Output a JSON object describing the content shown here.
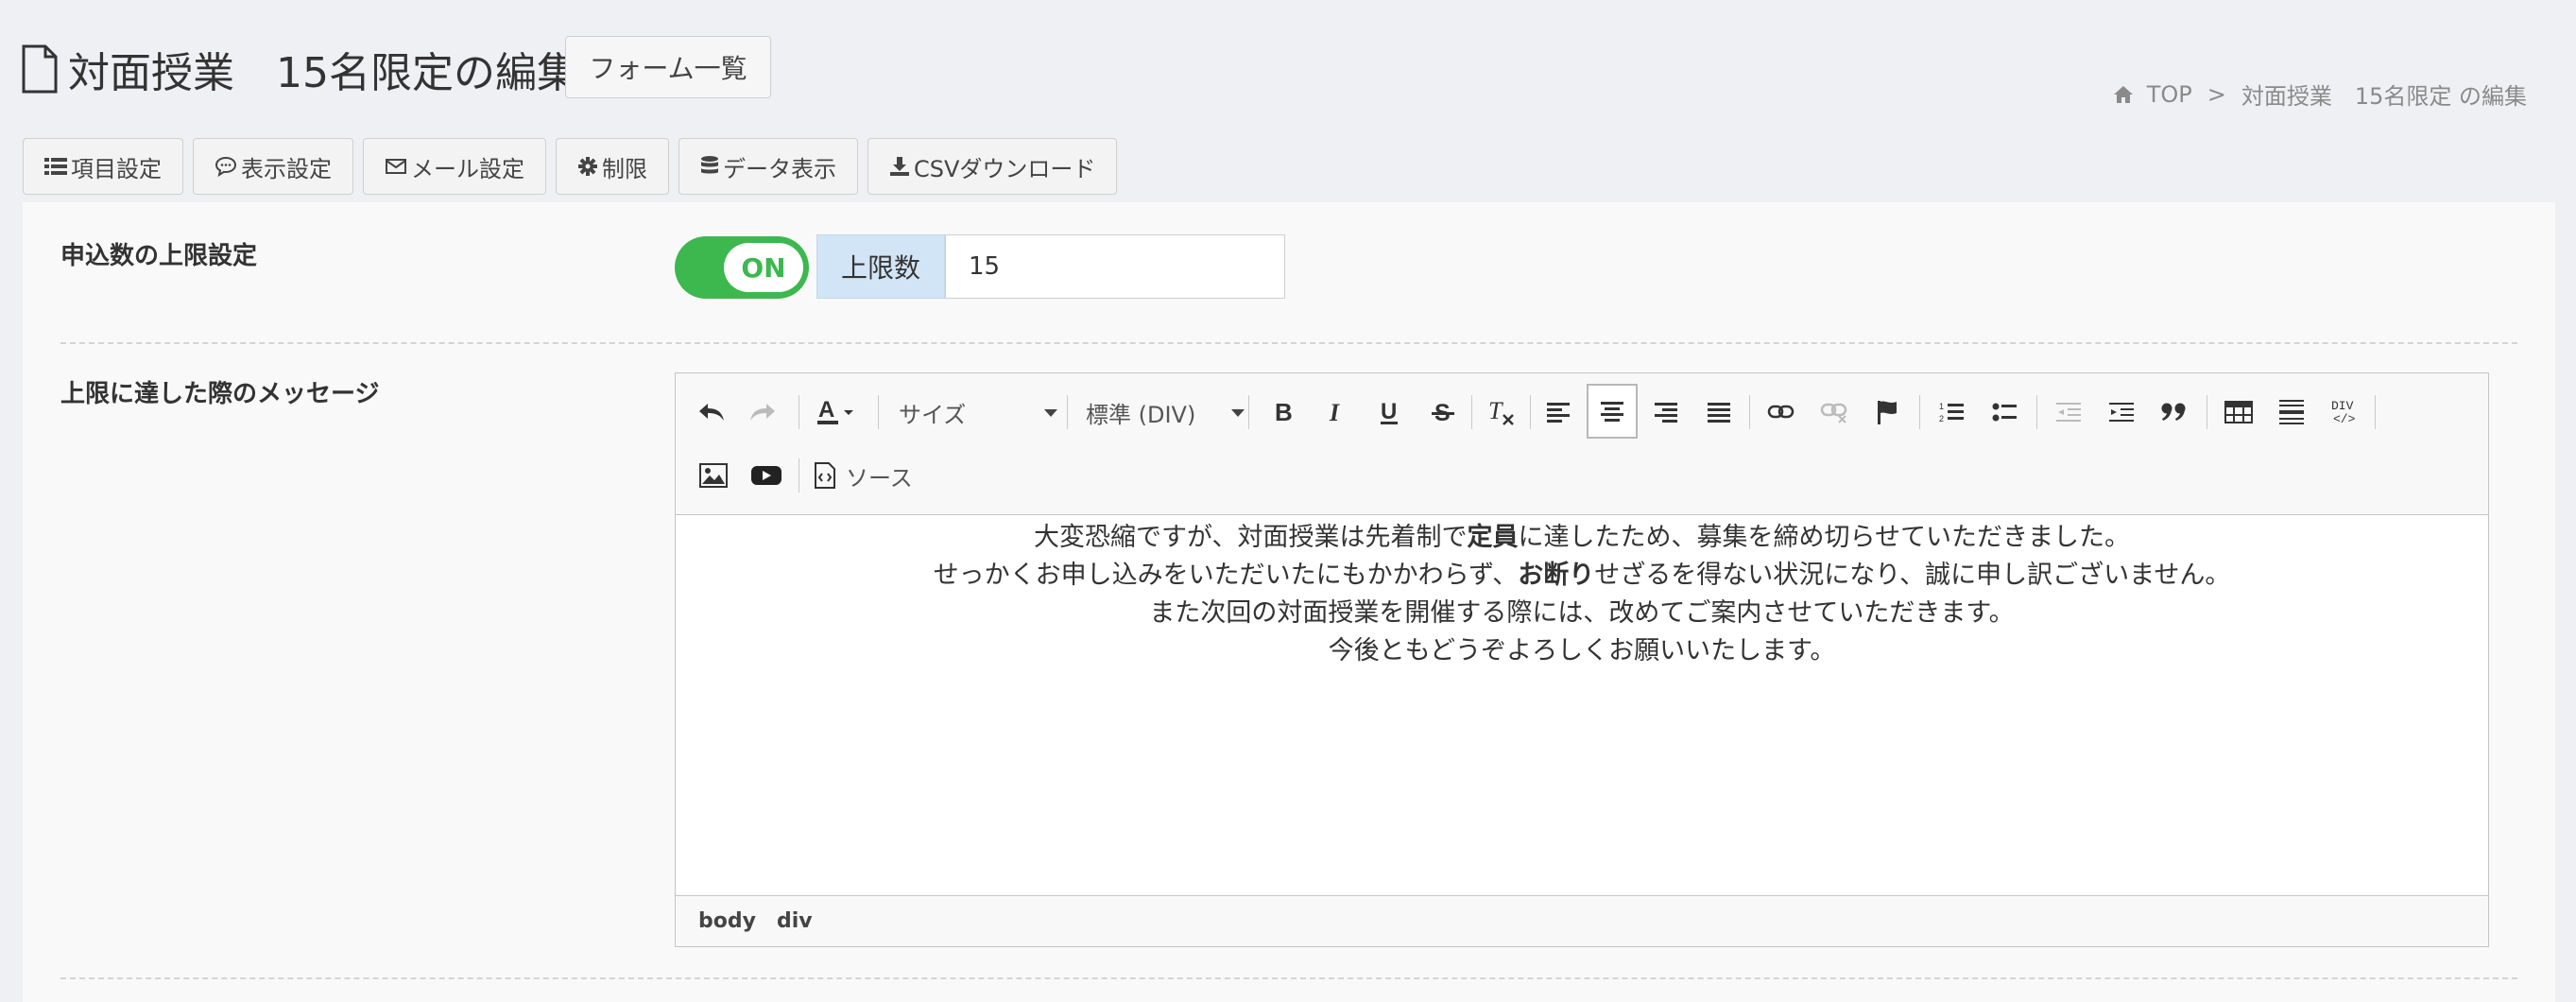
{
  "header": {
    "title": "対面授業　15名限定の編集",
    "list_button": "フォーム一覧"
  },
  "breadcrumb": {
    "home": "TOP",
    "separator": ">",
    "current": "対面授業　15名限定 の編集"
  },
  "tabs": [
    {
      "label": "項目設定",
      "icon": "list-icon"
    },
    {
      "label": "表示設定",
      "icon": "comment-icon"
    },
    {
      "label": "メール設定",
      "icon": "envelope-icon"
    },
    {
      "label": "制限",
      "icon": "gear-icon"
    },
    {
      "label": "データ表示",
      "icon": "database-icon"
    },
    {
      "label": "CSVダウンロード",
      "icon": "download-icon"
    }
  ],
  "limit_setting": {
    "label": "申込数の上限設定",
    "toggle_text": "ON",
    "toggle_on": true,
    "addon_label": "上限数",
    "value": "15"
  },
  "message_setting": {
    "label": "上限に達した際のメッセージ",
    "editor": {
      "size_placeholder": "サイズ",
      "format_value": "標準 (DIV)",
      "source_label": "ソース",
      "lines": [
        {
          "before": "大変恐縮ですが、対面授業は先着制で",
          "bold": "定員",
          "after": "に達したため、募集を締め切らせていただきました。"
        },
        {
          "before": "せっかくお申し込みをいただいたにもかかわらず、",
          "bold": "お断り",
          "after": "せざるを得ない状況になり、誠に申し訳ございません。"
        },
        {
          "before": "また次回の対面授業を開催する際には、改めてご案内させていただきます。",
          "bold": "",
          "after": ""
        },
        {
          "before": "今後ともどうぞよろしくお願いいたします。",
          "bold": "",
          "after": ""
        }
      ],
      "path": [
        "body",
        "div"
      ]
    }
  },
  "colors": {
    "toggle_on": "#3cb84e",
    "addon_bg": "#d2e5f7",
    "page_bg": "#eff0f4"
  }
}
